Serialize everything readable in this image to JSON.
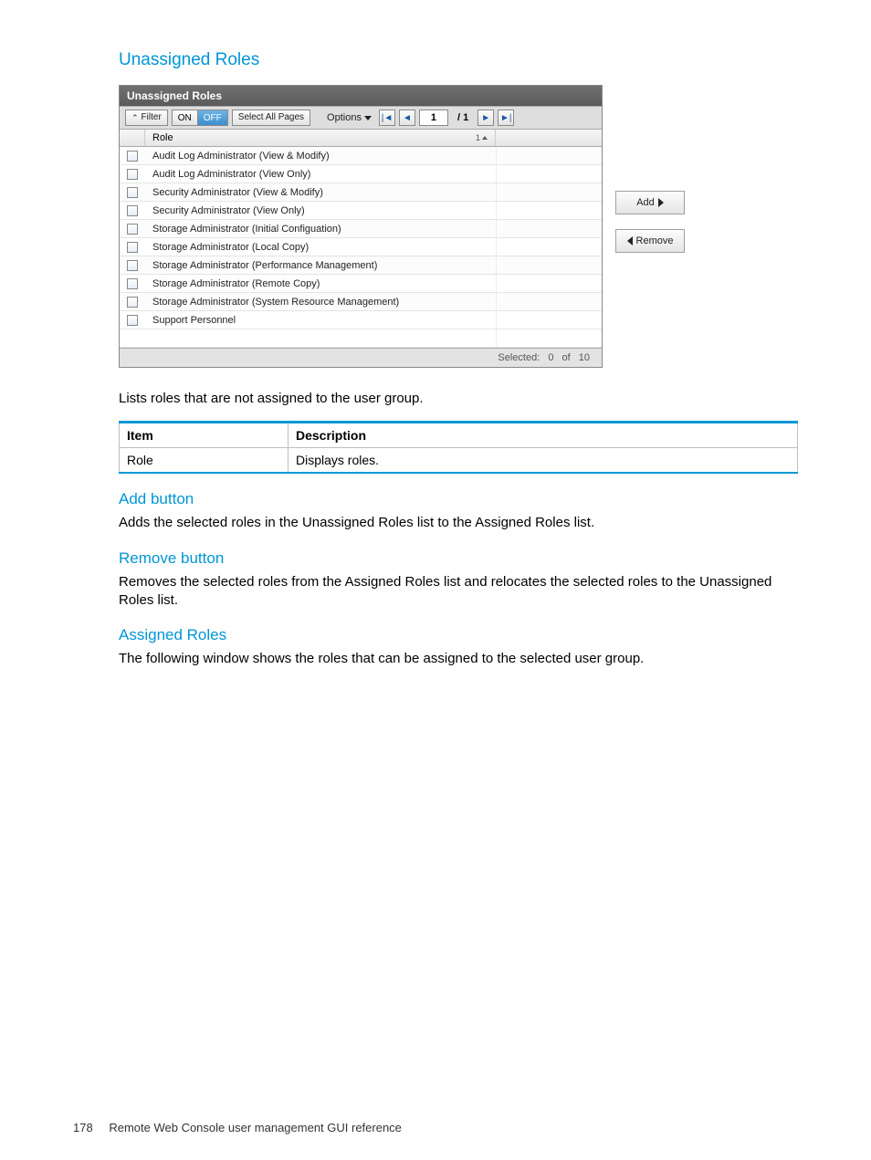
{
  "headings": {
    "unassigned": "Unassigned Roles",
    "add_button": "Add button",
    "remove_button": "Remove button",
    "assigned": "Assigned Roles"
  },
  "paragraphs": {
    "lists_roles": "Lists roles that are not assigned to the user group.",
    "add_desc": "Adds the selected roles in the Unassigned Roles list to the Assigned Roles list.",
    "remove_desc": "Removes the selected roles from the Assigned Roles list and relocates the selected roles to the Unassigned Roles list.",
    "assigned_desc": "The following window shows the roles that can be assigned to the selected user group."
  },
  "panel": {
    "title": "Unassigned Roles",
    "toolbar": {
      "filter_label": "Filter",
      "on": "ON",
      "off": "OFF",
      "select_all": "Select All Pages",
      "options": "Options",
      "page_current": "1",
      "page_sep": "/",
      "page_total": "1"
    },
    "columns": {
      "role": "Role",
      "sort_num": "1"
    },
    "rows": [
      "Audit Log Administrator (View & Modify)",
      "Audit Log Administrator (View Only)",
      "Security Administrator (View & Modify)",
      "Security Administrator (View Only)",
      "Storage Administrator (Initial Configuation)",
      "Storage Administrator (Local Copy)",
      "Storage Administrator (Performance Management)",
      "Storage Administrator (Remote Copy)",
      "Storage Administrator (System Resource Management)",
      "Support Personnel"
    ],
    "footer": {
      "selected_label": "Selected:",
      "selected_count": "0",
      "of_label": "of",
      "total": "10"
    }
  },
  "side_buttons": {
    "add": "Add",
    "remove": "Remove"
  },
  "doc_table": {
    "headers": {
      "item": "Item",
      "desc": "Description"
    },
    "rows": [
      {
        "item": "Role",
        "desc": "Displays roles."
      }
    ]
  },
  "page_footer": {
    "number": "178",
    "text": "Remote Web Console user management GUI reference"
  }
}
